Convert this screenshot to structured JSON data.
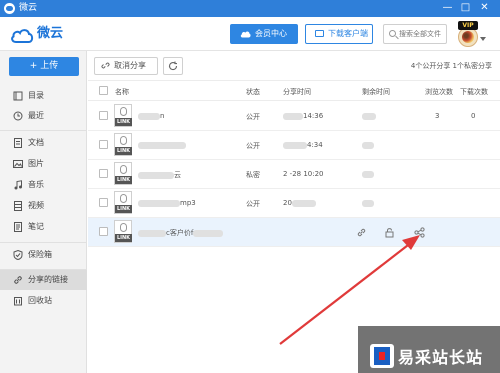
{
  "window": {
    "title": "微云"
  },
  "header": {
    "logo_text": "微云",
    "vip_label": "会员中心",
    "download_label": "下载客户端",
    "search_placeholder": "搜索全部文件",
    "avatar_badge": "VIP"
  },
  "sidebar": {
    "upload_label": "+ 上传",
    "items": [
      {
        "label": "目录",
        "icon": "directory-icon"
      },
      {
        "label": "最近",
        "icon": "clock-icon"
      },
      {
        "label": "文档",
        "icon": "document-icon"
      },
      {
        "label": "图片",
        "icon": "image-icon"
      },
      {
        "label": "音乐",
        "icon": "music-icon"
      },
      {
        "label": "视频",
        "icon": "video-icon"
      },
      {
        "label": "笔记",
        "icon": "note-icon"
      },
      {
        "label": "保险箱",
        "icon": "shield-icon"
      },
      {
        "label": "分享的链接",
        "icon": "link-icon"
      },
      {
        "label": "回收站",
        "icon": "trash-icon"
      }
    ],
    "active_index": 8
  },
  "toolbar": {
    "cancel_share_label": "取消分享",
    "share_summary": "4个公开分享  1个私密分享"
  },
  "table": {
    "columns": [
      "名称",
      "状态",
      "分享时间",
      "剩余时间",
      "浏览次数",
      "下载次数"
    ],
    "rows": [
      {
        "name_suffix": "n",
        "status": "公开",
        "time_suffix": "14:36",
        "views": "3",
        "downloads": "0"
      },
      {
        "name_suffix": "",
        "status": "公开",
        "time_suffix": "4:34",
        "views": "",
        "downloads": ""
      },
      {
        "name_suffix": "云",
        "status": "私密",
        "time_suffix": "2 -28 10:20",
        "views": "",
        "downloads": ""
      },
      {
        "name_suffix": "mp3",
        "status": "公开",
        "time_suffix": "20",
        "views": "",
        "downloads": ""
      },
      {
        "name_suffix": "c客户价f",
        "status": "",
        "time_suffix": "",
        "views": "",
        "downloads": ""
      }
    ],
    "file_badge": "LINK"
  },
  "watermark": {
    "text": "易采站长站"
  },
  "colors": {
    "titlebar": "#2f7fd9",
    "accent": "#2e86e2",
    "annotation_arrow": "#e03a3a"
  }
}
